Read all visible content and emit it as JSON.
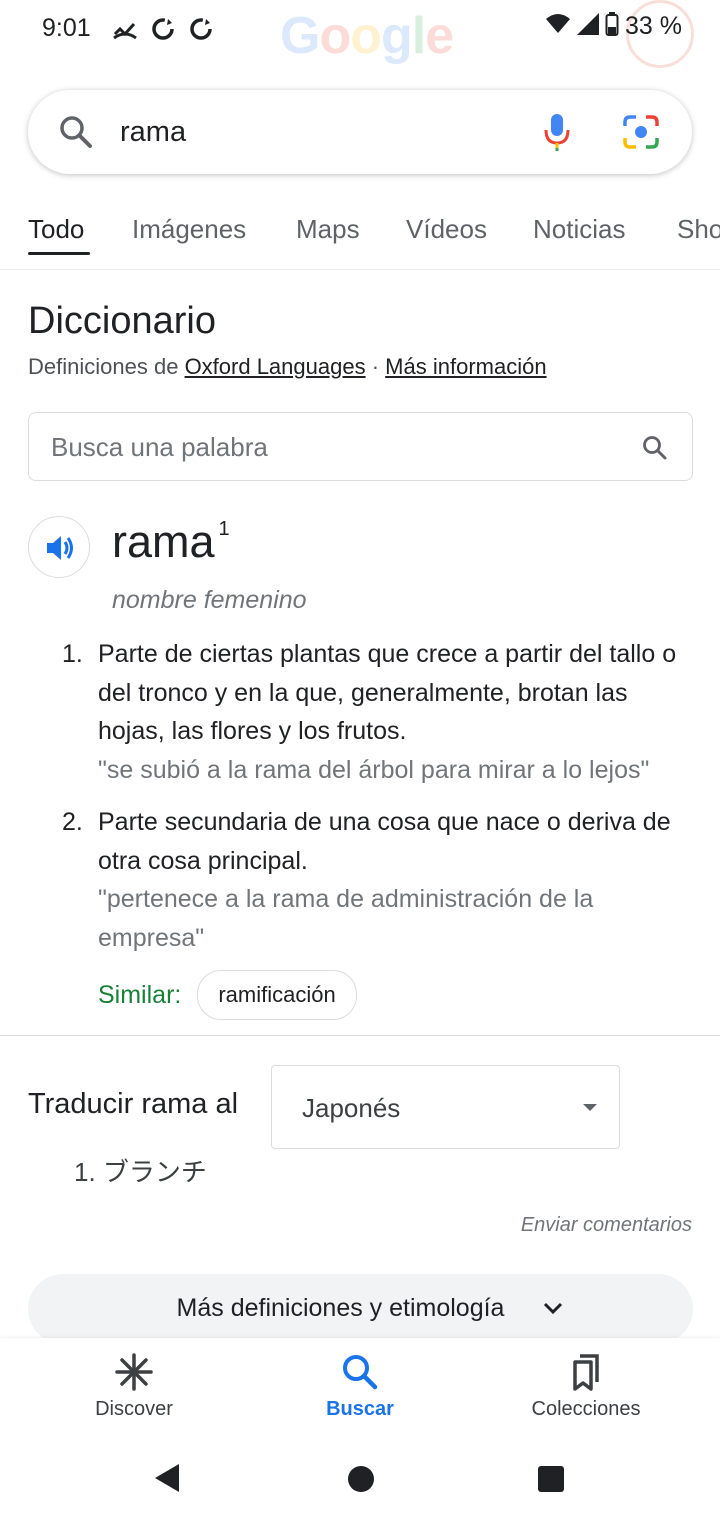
{
  "status_bar": {
    "time": "9:01",
    "battery": "33 %",
    "icons": [
      "missed-call-icon",
      "sync-icon",
      "sync-icon",
      "wifi-icon",
      "signal-icon",
      "battery-icon"
    ]
  },
  "watermark": "Google",
  "search": {
    "query": "rama",
    "icons": [
      "search-icon",
      "mic-icon",
      "lens-icon"
    ]
  },
  "tabs": [
    {
      "label": "Todo",
      "active": true
    },
    {
      "label": "Imágenes"
    },
    {
      "label": "Maps"
    },
    {
      "label": "Vídeos"
    },
    {
      "label": "Noticias"
    },
    {
      "label": "Sho"
    }
  ],
  "dictionary": {
    "title": "Diccionario",
    "source_prefix": "Definiciones de",
    "source_link": "Oxford Languages",
    "separator": "·",
    "more_info": "Más información",
    "search_placeholder": "Busca una palabra",
    "headword": "rama",
    "superscript": "1",
    "part_of_speech": "nombre femenino",
    "senses": [
      {
        "num": "1.",
        "definition": "Parte de ciertas plantas que crece a partir del tallo o del tronco y en la que, generalmente, brotan las hojas, las flores y los frutos.",
        "example": "\"se subió a la rama del árbol para mirar a lo lejos\""
      },
      {
        "num": "2.",
        "definition": "Parte secundaria de una cosa que nace o deriva de otra cosa principal.",
        "example": "\"pertenece a la rama de administración de la empresa\""
      }
    ],
    "similar_label": "Similar:",
    "similar_chip": "ramificación"
  },
  "translate": {
    "label": "Traducir rama al",
    "language": "Japonés",
    "result_num": "1.",
    "result": "ブランチ"
  },
  "feedback": "Enviar comentarios",
  "more_button": "Más definiciones y etimología",
  "bottom_nav": [
    {
      "label": "Discover",
      "icon": "discover-icon"
    },
    {
      "label": "Buscar",
      "icon": "search-icon",
      "active": true
    },
    {
      "label": "Colecciones",
      "icon": "collections-icon"
    }
  ],
  "colors": {
    "accent": "#1a73e8",
    "similar": "#188038",
    "text": "#202124",
    "muted": "#70757a"
  }
}
